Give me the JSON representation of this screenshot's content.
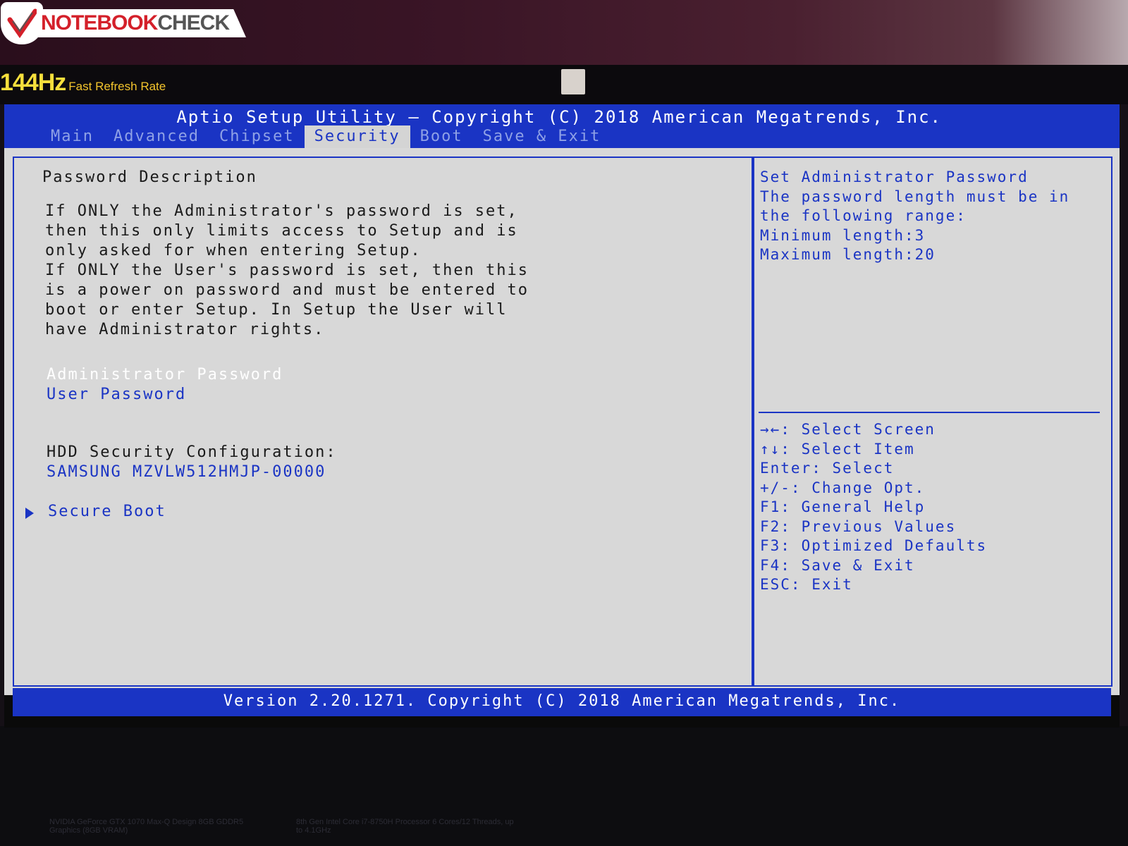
{
  "photo": {
    "logo_text_red": "NOTEBOOK",
    "logo_text_grey": "CHECK",
    "refresh_badge_number": "144Hz",
    "refresh_badge_label": "Fast Refresh Rate",
    "sticker_1": "NVIDIA GeForce GTX 1070 Max-Q Design 8GB GDDR5 Graphics (8GB VRAM)",
    "sticker_2": "8th Gen Intel Core i7-8750H Processor 6 Cores/12 Threads, up to 4.1GHz"
  },
  "bios": {
    "title": "Aptio Setup Utility – Copyright (C) 2018 American Megatrends, Inc.",
    "tabs": [
      {
        "label": "Main",
        "active": false
      },
      {
        "label": "Advanced",
        "active": false
      },
      {
        "label": "Chipset",
        "active": false
      },
      {
        "label": "Security",
        "active": true
      },
      {
        "label": "Boot",
        "active": false
      },
      {
        "label": "Save & Exit",
        "active": false
      }
    ],
    "main": {
      "section_title": "Password Description",
      "description_lines": [
        "If ONLY the Administrator's password is set,",
        "then this only limits access to Setup and is",
        "only asked for when entering Setup.",
        "If ONLY the User's password is set, then this",
        "is a power on password and must be entered to",
        "boot or enter Setup. In Setup the User will",
        "have Administrator rights."
      ],
      "admin_password": "Administrator Password",
      "user_password": "User Password",
      "hdd_label": "HDD Security Configuration:",
      "hdd_device": "SAMSUNG MZVLW512HMJP-00000",
      "secure_boot": "Secure Boot"
    },
    "help": {
      "lines": [
        "Set Administrator Password",
        "The password length must be in",
        "the following range:",
        "Minimum length:3",
        "Maximum length:20"
      ]
    },
    "keys": [
      "→←: Select Screen",
      "↑↓: Select Item",
      "Enter: Select",
      "+/-: Change Opt.",
      "F1: General Help",
      "F2: Previous Values",
      "F3: Optimized Defaults",
      "F4: Save & Exit",
      "ESC: Exit"
    ],
    "footer": "Version 2.20.1271. Copyright (C) 2018 American Megatrends, Inc.",
    "colors": {
      "accent_blue": "#1a34c4",
      "panel_grey": "#d8d8d8",
      "highlight_white": "#ffffff"
    }
  }
}
